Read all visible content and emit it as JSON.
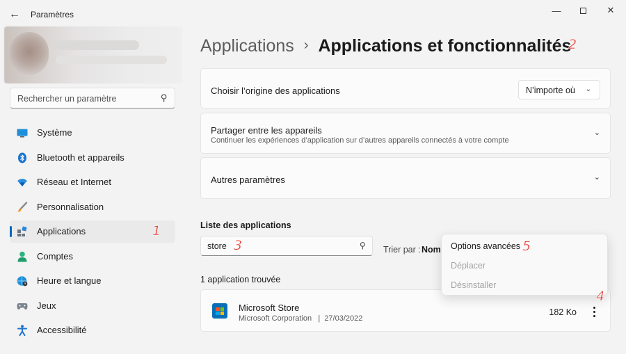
{
  "window": {
    "title": "Paramètres",
    "back_icon": "arrow-left-icon",
    "minimize_icon": "minimize-icon",
    "maximize_icon": "maximize-icon",
    "close_icon": "close-icon"
  },
  "sidebar": {
    "search_placeholder": "Rechercher un paramètre",
    "items": [
      {
        "label": "Système",
        "icon": "monitor-icon"
      },
      {
        "label": "Bluetooth et appareils",
        "icon": "bluetooth-icon"
      },
      {
        "label": "Réseau et Internet",
        "icon": "wifi-icon"
      },
      {
        "label": "Personnalisation",
        "icon": "brush-icon"
      },
      {
        "label": "Applications",
        "icon": "apps-icon",
        "selected": true
      },
      {
        "label": "Comptes",
        "icon": "person-icon"
      },
      {
        "label": "Heure et langue",
        "icon": "globe-clock-icon"
      },
      {
        "label": "Jeux",
        "icon": "gamepad-icon"
      },
      {
        "label": "Accessibilité",
        "icon": "accessibility-icon"
      }
    ]
  },
  "breadcrumb": {
    "parent": "Applications",
    "separator": "›",
    "current": "Applications et fonctionnalités"
  },
  "cards": {
    "origin": {
      "title": "Choisir l’origine des applications",
      "dropdown_value": "N’importe où"
    },
    "share": {
      "title": "Partager entre les appareils",
      "subtitle": "Continuer les expériences d’application sur d’autres appareils connectés à votre compte"
    },
    "other": {
      "title": "Autres paramètres"
    }
  },
  "app_list": {
    "title": "Liste des applications",
    "filter_value": "store",
    "sort_label": "Trier par :",
    "sort_value": "Nom",
    "count_text": "1 application trouvée",
    "apps": [
      {
        "name": "Microsoft Store",
        "publisher": "Microsoft Corporation",
        "separator": "|",
        "date": "27/03/2022",
        "size": "182 Ko"
      }
    ]
  },
  "context_menu": {
    "items": [
      {
        "label": "Options avancées",
        "enabled": true
      },
      {
        "label": "Déplacer",
        "enabled": false
      },
      {
        "label": "Désinstaller",
        "enabled": false
      }
    ]
  },
  "annotations": [
    "1",
    "2",
    "3",
    "4",
    "5"
  ],
  "colors": {
    "accent": "#0067c0",
    "annotation": "#e23a2e",
    "background": "#f3f3f3",
    "card": "#fbfbfb"
  }
}
